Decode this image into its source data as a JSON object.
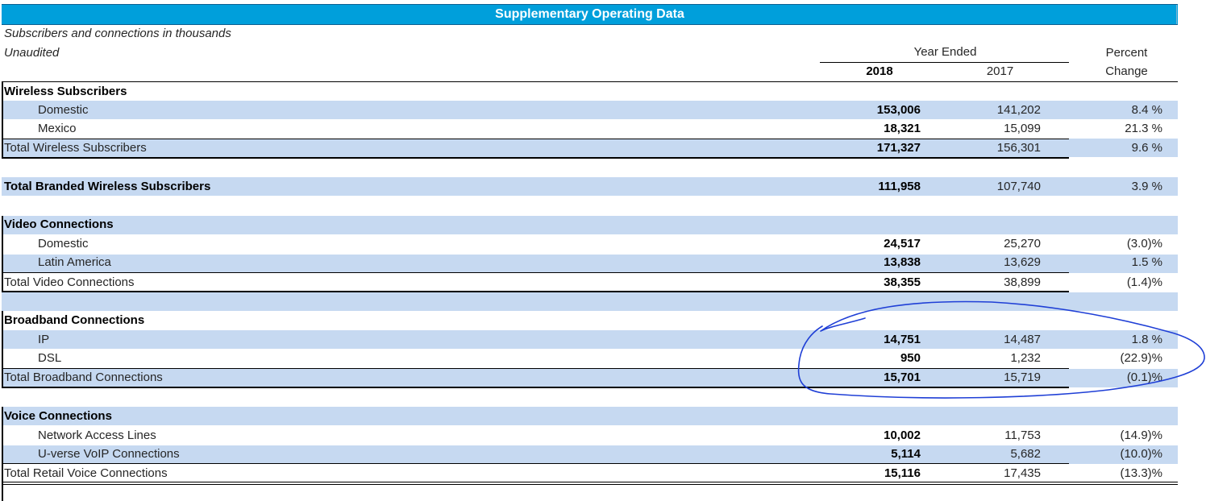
{
  "header": {
    "title": "Supplementary Operating Data"
  },
  "notes": {
    "units": "Subscribers and connections in thousands",
    "audit": "Unaudited"
  },
  "columns": {
    "year_ended": "Year Ended",
    "y2018": "2018",
    "y2017": "2017",
    "pct_line1": "Percent",
    "pct_line2": "Change"
  },
  "rows": [
    {
      "label": "Wireless Subscribers"
    },
    {
      "label": "Domestic",
      "v2018": "153,006",
      "v2017": "141,202",
      "pct": "8.4 %"
    },
    {
      "label": "Mexico",
      "v2018": "18,321",
      "v2017": "15,099",
      "pct": "21.3 %"
    },
    {
      "label": "Total Wireless Subscribers",
      "v2018": "171,327",
      "v2017": "156,301",
      "pct": "9.6 %"
    },
    {
      "label": "Total Branded Wireless Subscribers",
      "v2018": "111,958",
      "v2017": "107,740",
      "pct": "3.9 %"
    },
    {
      "label": "Video Connections"
    },
    {
      "label": "Domestic",
      "v2018": "24,517",
      "v2017": "25,270",
      "pct": "(3.0)%"
    },
    {
      "label": "Latin America",
      "v2018": "13,838",
      "v2017": "13,629",
      "pct": "1.5 %"
    },
    {
      "label": "Total Video Connections",
      "v2018": "38,355",
      "v2017": "38,899",
      "pct": "(1.4)%"
    },
    {
      "label": "Broadband Connections"
    },
    {
      "label": "IP",
      "v2018": "14,751",
      "v2017": "14,487",
      "pct": "1.8 %"
    },
    {
      "label": "DSL",
      "v2018": "950",
      "v2017": "1,232",
      "pct": "(22.9)%"
    },
    {
      "label": "Total Broadband Connections",
      "v2018": "15,701",
      "v2017": "15,719",
      "pct": "(0.1)%"
    },
    {
      "label": "Voice Connections"
    },
    {
      "label": "Network Access Lines",
      "v2018": "10,002",
      "v2017": "11,753",
      "pct": "(14.9)%"
    },
    {
      "label": "U-verse  VoIP Connections",
      "v2018": "5,114",
      "v2017": "5,682",
      "pct": "(10.0)%"
    },
    {
      "label": "Total Retail Voice Connections",
      "v2018": "15,116",
      "v2017": "17,435",
      "pct": "(13.3)%"
    }
  ],
  "colors": {
    "header_bg": "#009fdb",
    "band": "#c6d9f1",
    "annotation_ink": "#1f3fd6"
  }
}
